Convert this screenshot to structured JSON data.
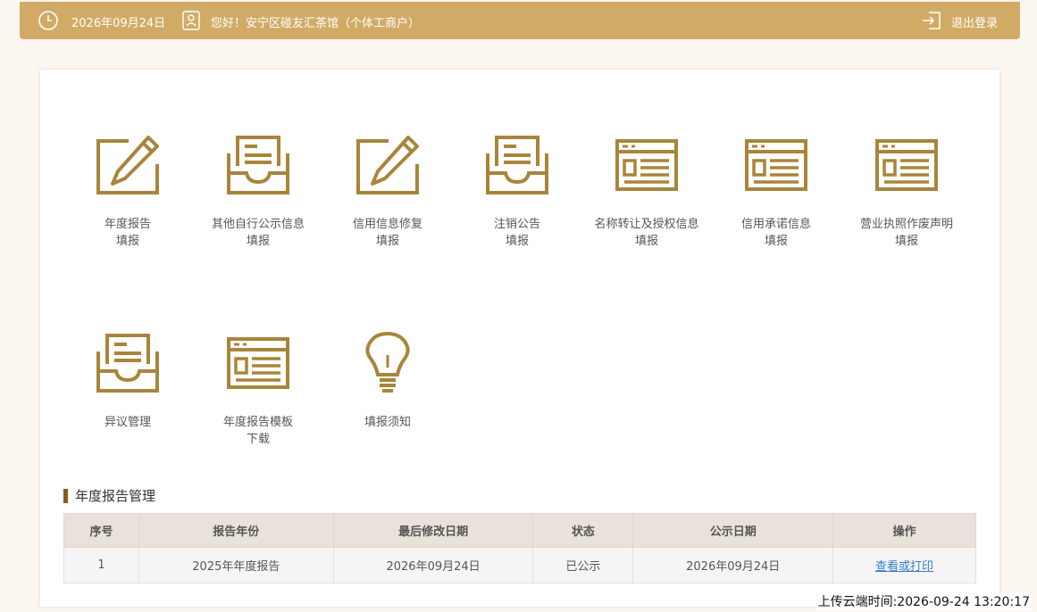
{
  "header": {
    "date": "2026年09月24日",
    "greeting": "您好！安宁区碰友汇茶馆（个体工商户）",
    "logout_label": "退出登录",
    "accent_color": "#d1ab66"
  },
  "tiles": [
    {
      "label": "年度报告\n填报",
      "icon": "pencil-edit-icon"
    },
    {
      "label": "其他自行公示信息\n填报",
      "icon": "inbox-tray-icon"
    },
    {
      "label": "信用信息修复\n填报",
      "icon": "pencil-edit-icon"
    },
    {
      "label": "注销公告\n填报",
      "icon": "inbox-tray-icon"
    },
    {
      "label": "名称转让及授权信息\n填报",
      "icon": "browser-window-icon"
    },
    {
      "label": "信用承诺信息\n填报",
      "icon": "browser-window-icon"
    },
    {
      "label": "营业执照作废声明\n填报",
      "icon": "browser-window-icon"
    },
    {
      "label": "异议管理",
      "icon": "inbox-tray-icon"
    },
    {
      "label": "年度报告模板\n下载",
      "icon": "browser-window-icon"
    },
    {
      "label": "填报须知",
      "icon": "lightbulb-icon"
    }
  ],
  "section": {
    "title": "年度报告管理"
  },
  "table": {
    "headers": [
      "序号",
      "报告年份",
      "最后修改日期",
      "状态",
      "公示日期",
      "操作"
    ],
    "rows": [
      [
        "1",
        "2025年年度报告",
        "2026年09月24日",
        "已公示",
        "2026年09月24日",
        "查看或打印"
      ]
    ]
  },
  "footer": {
    "upload_time": "上传云端时间:2026-09-24 13:20:17"
  },
  "icon_color": "#a8853a"
}
